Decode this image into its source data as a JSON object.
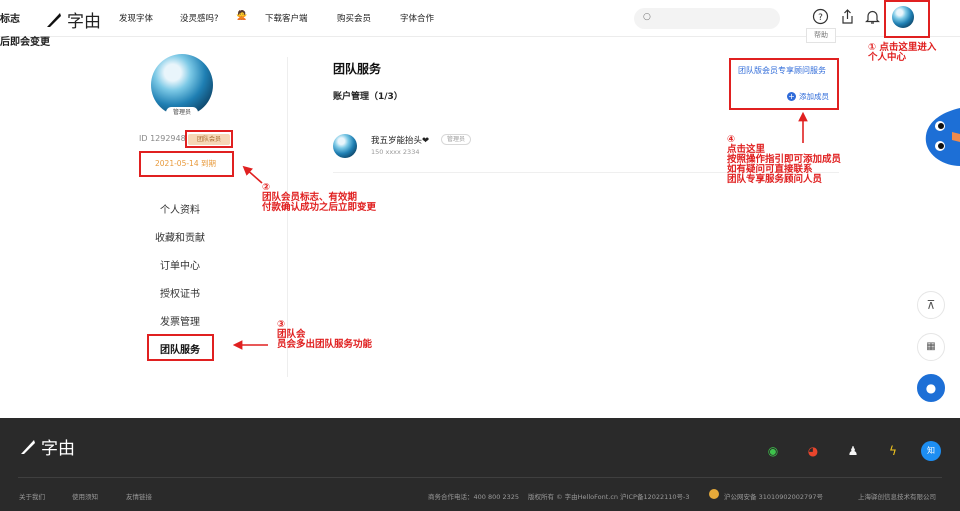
{
  "header": {
    "left_fragment": "标志",
    "brand": "字由",
    "nav": [
      "发现字体",
      "没灵感吗?",
      "下载客户端",
      "购买会员",
      "字体合作"
    ],
    "search_placeholder": "",
    "tooltip": "帮助"
  },
  "overlay_fragment": "后即会变更",
  "profile": {
    "role_tag": "管理员",
    "id_text": "ID 1292948",
    "badge": "团队会员",
    "expiry": "2021-05-14 到期"
  },
  "menu": [
    "个人资料",
    "收藏和贡献",
    "订单中心",
    "授权证书",
    "发票管理",
    "团队服务"
  ],
  "main": {
    "title": "团队服务",
    "account_mgmt": "账户管理（1/3）",
    "consult_link": "团队版会员专享顾问服务",
    "add_member": "添加成员",
    "member": {
      "name": "我五岁能抬头❤",
      "role": "管理员",
      "phone": "150 xxxx 2334"
    }
  },
  "annotations": {
    "a1_num": "①",
    "a1_l1": "点击这里进入",
    "a1_l2": "个人中心",
    "a2_num": "②",
    "a2_l1": "团队会员标志、有效期",
    "a2_l2": "付款确认成功之后立即变更",
    "a3_num": "③",
    "a3_l1": "团队会",
    "a3_l2": "员会多出团队服务功能",
    "a4_num": "④",
    "a4_l1": "点击这里",
    "a4_l2": "按照操作指引即可添加成员",
    "a4_l3": "如有疑问可直接联系",
    "a4_l4": "团队专享服务顾问人员"
  },
  "footer": {
    "brand": "字由",
    "links": [
      "关于我们",
      "使用须知",
      "友情链接"
    ],
    "phone": "商务合作电话：400 800 2325",
    "copyright": "版权所有 © 字由HelloFont.cn 沪ICP备12022110号-3",
    "police": "沪公网安备 31010902002797号",
    "company": "上海驿创信息技术有限公司",
    "social_icons": [
      "wechat-icon",
      "weibo-icon",
      "qq-icon",
      "zcool-icon",
      "zhihu-icon"
    ]
  },
  "colors": {
    "accent": "#2f6bd9",
    "annotation": "#e02020",
    "badge_bg": "#f6d7b6",
    "expiry": "#e89a3c",
    "footer_bg": "#2a2a2a"
  }
}
